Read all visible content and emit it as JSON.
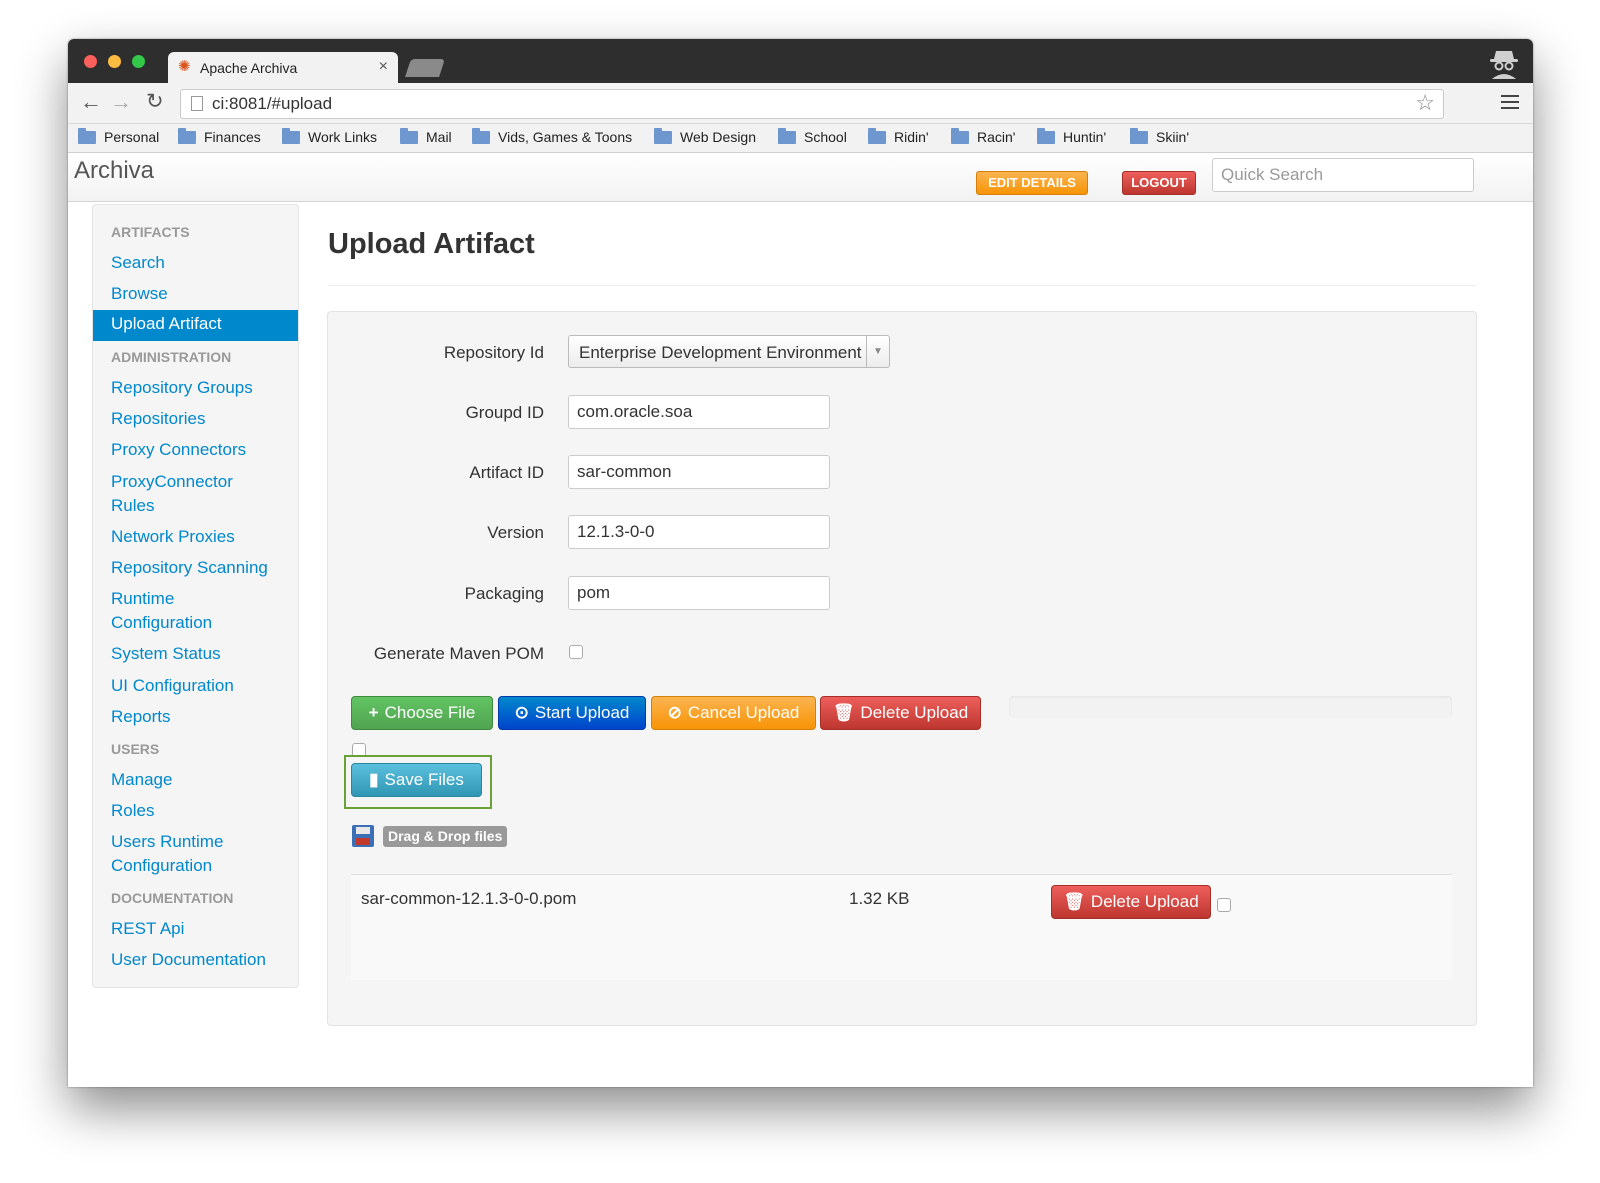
{
  "browser": {
    "tab_title": "Apache Archiva",
    "tab_close": "×",
    "url": "ci:8081/#upload",
    "bookmarks": [
      "Personal",
      "Finances",
      "Work Links",
      "Mail",
      "Vids, Games & Toons",
      "Web Design",
      "School",
      "Ridin'",
      "Racin'",
      "Huntin'",
      "Skiin'"
    ]
  },
  "navbar": {
    "brand": "Archiva",
    "edit_details": "EDIT DETAILS",
    "logout": "LOGOUT",
    "search_placeholder": "Quick Search"
  },
  "sidebar": {
    "artifacts_header": "ARTIFACTS",
    "search": "Search",
    "browse": "Browse",
    "upload_artifact": "Upload Artifact",
    "administration_header": "ADMINISTRATION",
    "repository_groups": "Repository Groups",
    "repositories": "Repositories",
    "proxy_connectors": "Proxy Connectors",
    "proxyconnector_rules_1": "ProxyConnector",
    "proxyconnector_rules_2": "Rules",
    "network_proxies": "Network Proxies",
    "repository_scanning": "Repository Scanning",
    "runtime_configuration_1": "Runtime",
    "runtime_configuration_2": "Configuration",
    "system_status": "System Status",
    "ui_configuration": "UI Configuration",
    "reports": "Reports",
    "users_header": "USERS",
    "manage": "Manage",
    "roles": "Roles",
    "users_runtime_configuration_1": "Users Runtime",
    "users_runtime_configuration_2": "Configuration",
    "documentation_header": "DOCUMENTATION",
    "rest_api": "REST Api",
    "user_documentation": "User Documentation"
  },
  "main": {
    "title": "Upload Artifact",
    "form": {
      "repository_id_label": "Repository Id",
      "repository_id_value": "Enterprise Development Environment",
      "group_id_label": "Groupd ID",
      "group_id_value": "com.oracle.soa",
      "artifact_id_label": "Artifact ID",
      "artifact_id_value": "sar-common",
      "version_label": "Version",
      "version_value": "12.1.3-0-0",
      "packaging_label": "Packaging",
      "packaging_value": "pom",
      "generate_pom_label": "Generate Maven POM"
    },
    "buttons": {
      "choose_file": "Choose File",
      "start_upload": "Start Upload",
      "cancel_upload": "Cancel Upload",
      "delete_upload": "Delete Upload",
      "save_files": "Save Files"
    },
    "drag_drop": "Drag & Drop files",
    "files": [
      {
        "name": "sar-common-12.1.3-0-0.pom",
        "size": "1.32 KB",
        "delete_label": "Delete Upload"
      }
    ]
  }
}
